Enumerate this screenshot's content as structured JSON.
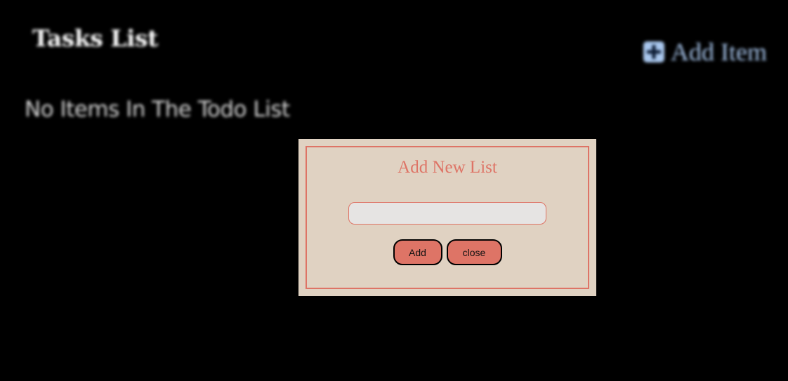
{
  "header": {
    "title": "Tasks List",
    "add_item_label": "Add Item",
    "add_item_icon": "plus-square-icon"
  },
  "main": {
    "empty_message": "No Items In The Todo List"
  },
  "modal": {
    "title": "Add New List",
    "input_value": "",
    "input_placeholder": "",
    "add_label": "Add",
    "close_label": "close"
  },
  "colors": {
    "background": "#000000",
    "accent": "#de7466",
    "modal_background": "#e0d2c2",
    "add_item_color": "#a9c7ee"
  }
}
